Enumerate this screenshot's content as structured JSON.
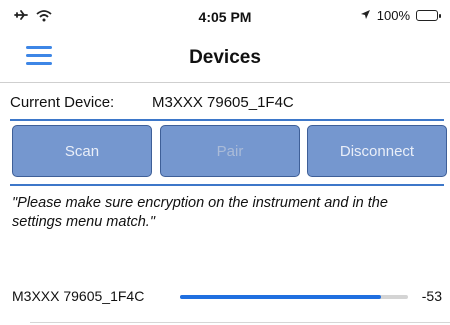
{
  "status_bar": {
    "time": "4:05 PM",
    "battery_text": "100%",
    "battery_color": "#39c53b",
    "icons": [
      "airplane-icon",
      "wifi-icon",
      "location-arrow-icon",
      "battery-icon"
    ]
  },
  "nav": {
    "title": "Devices",
    "menu_icon": "hamburger-menu-icon",
    "accent_color": "#3d86e6"
  },
  "current_device": {
    "label": "Current Device:",
    "value": "M3XXX 79605_1F4C"
  },
  "buttons": {
    "scan": "Scan",
    "pair": "Pair",
    "disconnect": "Disconnect",
    "color": "#7597cf"
  },
  "message": "\"Please make sure encryption on the instrument and in the settings menu match.\"",
  "device_list": [
    {
      "name": "M3XXX 79605_1F4C",
      "rssi": "-53",
      "signal_fraction": 0.88
    }
  ]
}
